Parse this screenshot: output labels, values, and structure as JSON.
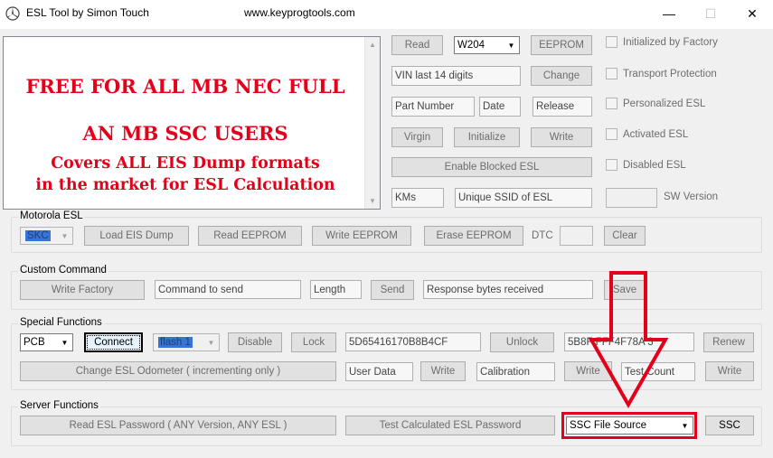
{
  "window": {
    "title": "ESL Tool by Simon Touch",
    "url": "www.keyprogtools.com",
    "controls": {
      "minimize": "—",
      "maximize": "☐",
      "close": "✕"
    }
  },
  "banner": {
    "lines": [
      "FREE FOR ALL MB NEC FULL",
      "AN MB SSC USERS",
      "Covers ALL EIS Dump formats",
      "in the market for ESL Calculation"
    ],
    "color": "#e4001b"
  },
  "top": {
    "read": "Read",
    "model": "W204",
    "eeprom": "EEPROM",
    "vin": "VIN last 14 digits",
    "change": "Change",
    "part_number": "Part Number",
    "date": "Date",
    "release": "Release",
    "virgin": "Virgin",
    "initialize": "Initialize",
    "write": "Write",
    "enable_blocked": "Enable Blocked ESL",
    "kms": "KMs",
    "ssid": "Unique SSID of ESL",
    "sw_version": "SW Version"
  },
  "status": [
    "Initialized by Factory",
    "Transport Protection",
    "Personalized ESL",
    "Activated ESL",
    "Disabled ESL"
  ],
  "motorola": {
    "title": "Motorola ESL",
    "type": "SKC",
    "load": "Load EIS Dump",
    "read": "Read EEPROM",
    "write": "Write EEPROM",
    "erase": "Erase EEPROM",
    "dtc": "DTC",
    "clear": "Clear"
  },
  "custom": {
    "title": "Custom Command",
    "write_factory": "Write Factory",
    "command": "Command to send",
    "length": "Length",
    "send": "Send",
    "response": "Response bytes received",
    "save": "Save"
  },
  "special": {
    "title": "Special Functions",
    "port": "PCB",
    "connect": "Connect",
    "flash": "flash 1",
    "disable": "Disable",
    "lock": "Lock",
    "key1": "5D65416170B8B4CF",
    "unlock": "Unlock",
    "key2": "5B8F   FFF4F78A  3",
    "renew": "Renew",
    "odometer": "Change ESL Odometer ( incrementing only )",
    "user_data": "User Data",
    "write1": "Write",
    "calibration": "Calibration",
    "write2": "Write",
    "test_count": "Test Count",
    "write3": "Write"
  },
  "server": {
    "title": "Server Functions",
    "read_pw": "Read ESL Password ( ANY Version, ANY ESL )",
    "test_pw": "Test Calculated ESL Password",
    "source": "SSC File Source",
    "ssc": "SSC"
  },
  "annotation_color": "#e4001b"
}
